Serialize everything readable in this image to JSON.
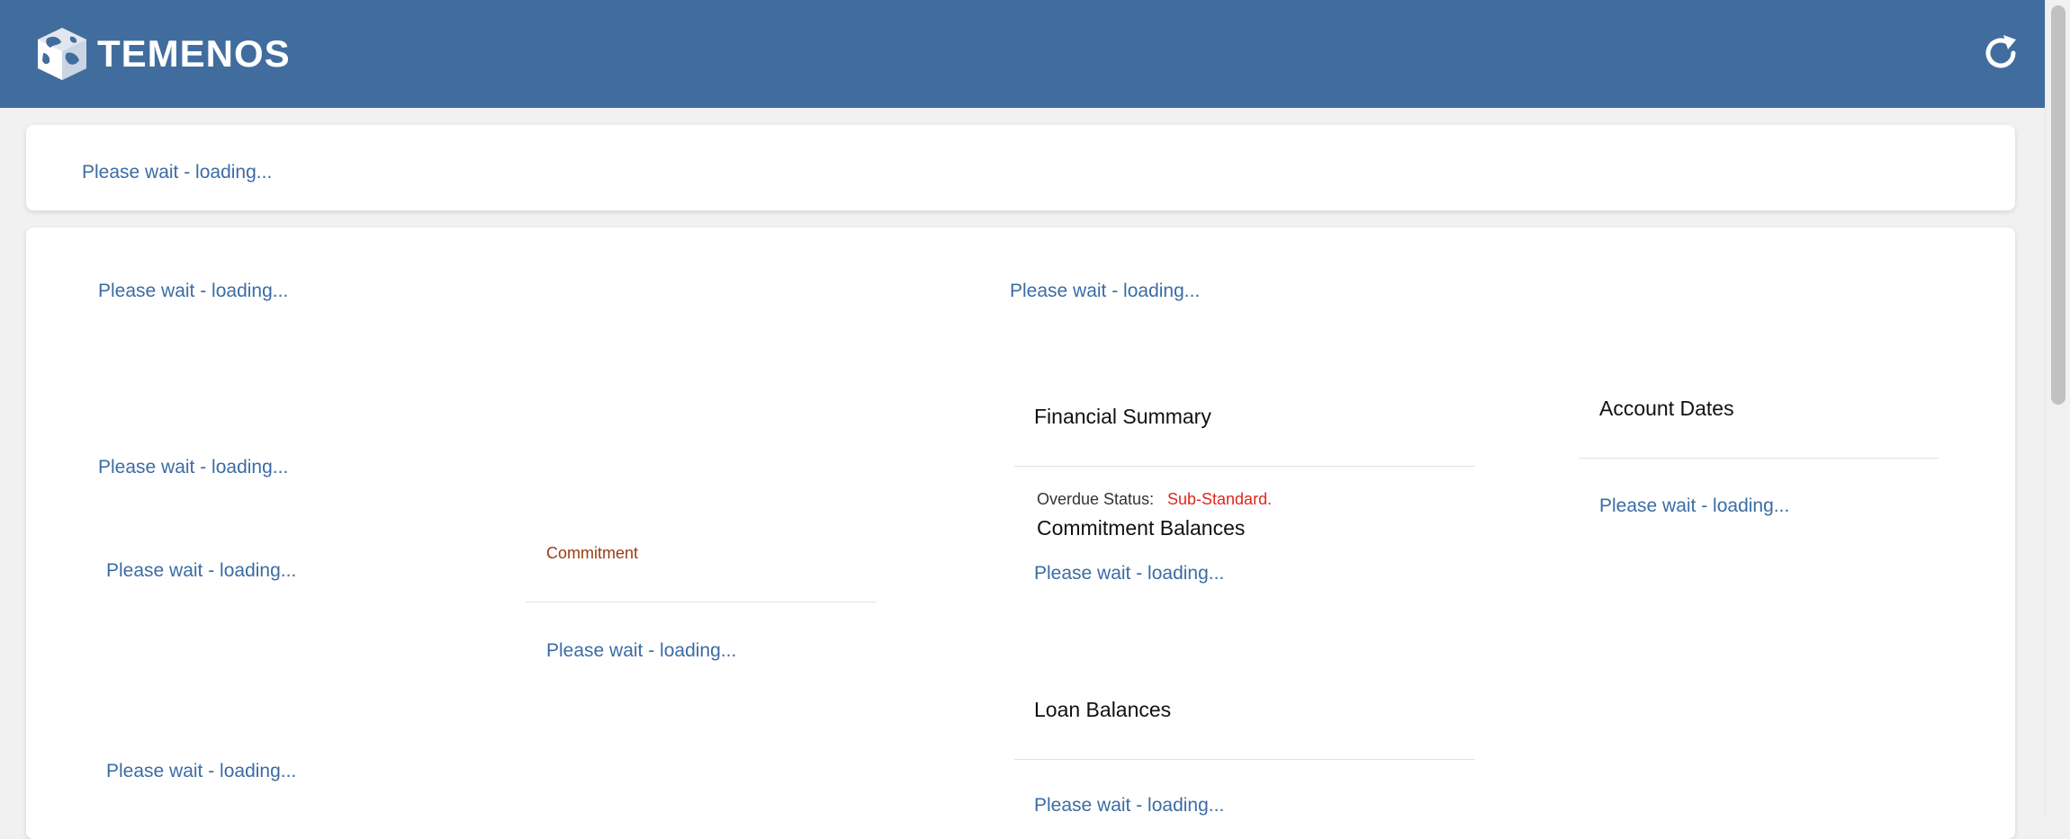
{
  "header": {
    "brand": "TEMENOS",
    "logo_icon": "temenos-globe-icon",
    "refresh_icon": "refresh-icon",
    "background_color": "#416d9e"
  },
  "top_panel": {
    "loading_text": "Please wait - loading..."
  },
  "main": {
    "loading_1": "Please wait - loading...",
    "loading_2": "Please wait - loading...",
    "loading_3": "Please wait - loading...",
    "loading_4": "Please wait - loading...",
    "loading_5": "Please wait - loading...",
    "commitment_section": {
      "label": "Commitment",
      "loading_text": "Please wait - loading..."
    },
    "financial_summary": {
      "title": "Financial Summary",
      "overdue_label": "Overdue Status:",
      "overdue_value": "Sub-Standard.",
      "commitment_balances_title": "Commitment Balances",
      "commitment_balances_loading": "Please wait - loading...",
      "loan_balances_title": "Loan Balances",
      "loan_balances_loading": "Please wait - loading..."
    },
    "account_dates": {
      "title": "Account Dates",
      "loading_text": "Please wait - loading..."
    }
  }
}
